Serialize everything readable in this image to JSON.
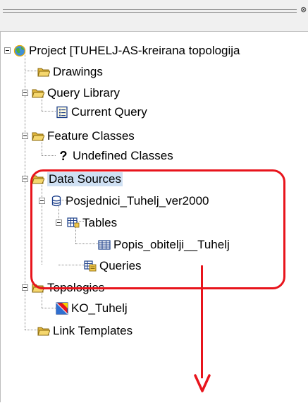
{
  "window": {
    "close_glyph": "⊗"
  },
  "tree": {
    "project": {
      "label": "Project [TUHELJ-AS-kreirana topologija",
      "icon": "globe-icon"
    },
    "drawings": {
      "label": "Drawings",
      "icon": "folder-icon"
    },
    "query_library": {
      "label": "Query Library",
      "icon": "folder-icon"
    },
    "current_query": {
      "label": "Current Query",
      "icon": "query-icon"
    },
    "feature_classes": {
      "label": "Feature Classes",
      "icon": "folder-icon"
    },
    "undefined_classes": {
      "label": "Undefined Classes",
      "glyph": "?"
    },
    "data_sources": {
      "label": "Data Sources",
      "icon": "folder-icon",
      "selected": true
    },
    "posjednici": {
      "label": "Posjednici_Tuhelj_ver2000",
      "icon": "database-icon"
    },
    "tables": {
      "label": "Tables",
      "icon": "tables-icon"
    },
    "popis": {
      "label": "Popis_obitelji__Tuhelj",
      "icon": "table-icon"
    },
    "queries": {
      "label": "Queries",
      "icon": "queries-icon"
    },
    "topologies": {
      "label": "Topologies",
      "icon": "folder-icon"
    },
    "ko_tuhelj": {
      "label": "KO_Tuhelj",
      "icon": "topology-icon"
    },
    "link_templates": {
      "label": "Link Templates",
      "icon": "folder-icon"
    }
  },
  "colors": {
    "highlight": "#e8141c",
    "folder": "#f2c94c",
    "selection": "#cfe0f3",
    "tree_line": "#8a8a8a"
  }
}
